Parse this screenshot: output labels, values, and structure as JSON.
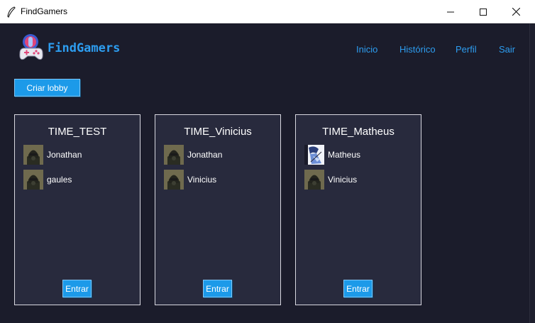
{
  "window": {
    "title": "FindGamers"
  },
  "header": {
    "logo_text": "FindGamers",
    "nav": {
      "inicio": "Inicio",
      "historico": "Histórico",
      "perfil": "Perfil",
      "sair": "Sair"
    }
  },
  "actions": {
    "create_lobby": "Criar lobby"
  },
  "lobbies": [
    {
      "name": "TIME_TEST",
      "members": [
        {
          "name": "Jonathan",
          "avatar": "masked-soldier-avatar"
        },
        {
          "name": "gaules",
          "avatar": "masked-soldier-avatar"
        }
      ],
      "join_label": "Entrar"
    },
    {
      "name": "TIME_Vinicius",
      "members": [
        {
          "name": "Jonathan",
          "avatar": "masked-soldier-avatar"
        },
        {
          "name": "Vinicius",
          "avatar": "masked-soldier-avatar"
        }
      ],
      "join_label": "Entrar"
    },
    {
      "name": "TIME_Matheus",
      "members": [
        {
          "name": "Matheus",
          "avatar": "anime-character-avatar"
        },
        {
          "name": "Vinicius",
          "avatar": "masked-soldier-avatar"
        }
      ],
      "join_label": "Entrar"
    }
  ],
  "colors": {
    "background": "#1b1c2b",
    "card": "#282a3d",
    "accent": "#1c9ae9",
    "link": "#2d9df0"
  }
}
